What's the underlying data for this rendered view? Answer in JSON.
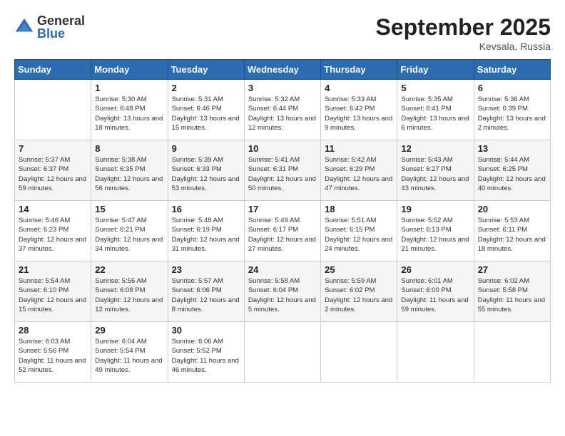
{
  "logo": {
    "general": "General",
    "blue": "Blue"
  },
  "title": "September 2025",
  "location": "Kevsala, Russia",
  "days_of_week": [
    "Sunday",
    "Monday",
    "Tuesday",
    "Wednesday",
    "Thursday",
    "Friday",
    "Saturday"
  ],
  "weeks": [
    [
      {
        "day": "",
        "sunrise": "",
        "sunset": "",
        "daylight": ""
      },
      {
        "day": "1",
        "sunrise": "Sunrise: 5:30 AM",
        "sunset": "Sunset: 6:48 PM",
        "daylight": "Daylight: 13 hours and 18 minutes."
      },
      {
        "day": "2",
        "sunrise": "Sunrise: 5:31 AM",
        "sunset": "Sunset: 6:46 PM",
        "daylight": "Daylight: 13 hours and 15 minutes."
      },
      {
        "day": "3",
        "sunrise": "Sunrise: 5:32 AM",
        "sunset": "Sunset: 6:44 PM",
        "daylight": "Daylight: 13 hours and 12 minutes."
      },
      {
        "day": "4",
        "sunrise": "Sunrise: 5:33 AM",
        "sunset": "Sunset: 6:42 PM",
        "daylight": "Daylight: 13 hours and 9 minutes."
      },
      {
        "day": "5",
        "sunrise": "Sunrise: 5:35 AM",
        "sunset": "Sunset: 6:41 PM",
        "daylight": "Daylight: 13 hours and 6 minutes."
      },
      {
        "day": "6",
        "sunrise": "Sunrise: 5:36 AM",
        "sunset": "Sunset: 6:39 PM",
        "daylight": "Daylight: 13 hours and 2 minutes."
      }
    ],
    [
      {
        "day": "7",
        "sunrise": "Sunrise: 5:37 AM",
        "sunset": "Sunset: 6:37 PM",
        "daylight": "Daylight: 12 hours and 59 minutes."
      },
      {
        "day": "8",
        "sunrise": "Sunrise: 5:38 AM",
        "sunset": "Sunset: 6:35 PM",
        "daylight": "Daylight: 12 hours and 56 minutes."
      },
      {
        "day": "9",
        "sunrise": "Sunrise: 5:39 AM",
        "sunset": "Sunset: 6:33 PM",
        "daylight": "Daylight: 12 hours and 53 minutes."
      },
      {
        "day": "10",
        "sunrise": "Sunrise: 5:41 AM",
        "sunset": "Sunset: 6:31 PM",
        "daylight": "Daylight: 12 hours and 50 minutes."
      },
      {
        "day": "11",
        "sunrise": "Sunrise: 5:42 AM",
        "sunset": "Sunset: 6:29 PM",
        "daylight": "Daylight: 12 hours and 47 minutes."
      },
      {
        "day": "12",
        "sunrise": "Sunrise: 5:43 AM",
        "sunset": "Sunset: 6:27 PM",
        "daylight": "Daylight: 12 hours and 43 minutes."
      },
      {
        "day": "13",
        "sunrise": "Sunrise: 5:44 AM",
        "sunset": "Sunset: 6:25 PM",
        "daylight": "Daylight: 12 hours and 40 minutes."
      }
    ],
    [
      {
        "day": "14",
        "sunrise": "Sunrise: 5:46 AM",
        "sunset": "Sunset: 6:23 PM",
        "daylight": "Daylight: 12 hours and 37 minutes."
      },
      {
        "day": "15",
        "sunrise": "Sunrise: 5:47 AM",
        "sunset": "Sunset: 6:21 PM",
        "daylight": "Daylight: 12 hours and 34 minutes."
      },
      {
        "day": "16",
        "sunrise": "Sunrise: 5:48 AM",
        "sunset": "Sunset: 6:19 PM",
        "daylight": "Daylight: 12 hours and 31 minutes."
      },
      {
        "day": "17",
        "sunrise": "Sunrise: 5:49 AM",
        "sunset": "Sunset: 6:17 PM",
        "daylight": "Daylight: 12 hours and 27 minutes."
      },
      {
        "day": "18",
        "sunrise": "Sunrise: 5:51 AM",
        "sunset": "Sunset: 6:15 PM",
        "daylight": "Daylight: 12 hours and 24 minutes."
      },
      {
        "day": "19",
        "sunrise": "Sunrise: 5:52 AM",
        "sunset": "Sunset: 6:13 PM",
        "daylight": "Daylight: 12 hours and 21 minutes."
      },
      {
        "day": "20",
        "sunrise": "Sunrise: 5:53 AM",
        "sunset": "Sunset: 6:11 PM",
        "daylight": "Daylight: 12 hours and 18 minutes."
      }
    ],
    [
      {
        "day": "21",
        "sunrise": "Sunrise: 5:54 AM",
        "sunset": "Sunset: 6:10 PM",
        "daylight": "Daylight: 12 hours and 15 minutes."
      },
      {
        "day": "22",
        "sunrise": "Sunrise: 5:56 AM",
        "sunset": "Sunset: 6:08 PM",
        "daylight": "Daylight: 12 hours and 12 minutes."
      },
      {
        "day": "23",
        "sunrise": "Sunrise: 5:57 AM",
        "sunset": "Sunset: 6:06 PM",
        "daylight": "Daylight: 12 hours and 8 minutes."
      },
      {
        "day": "24",
        "sunrise": "Sunrise: 5:58 AM",
        "sunset": "Sunset: 6:04 PM",
        "daylight": "Daylight: 12 hours and 5 minutes."
      },
      {
        "day": "25",
        "sunrise": "Sunrise: 5:59 AM",
        "sunset": "Sunset: 6:02 PM",
        "daylight": "Daylight: 12 hours and 2 minutes."
      },
      {
        "day": "26",
        "sunrise": "Sunrise: 6:01 AM",
        "sunset": "Sunset: 6:00 PM",
        "daylight": "Daylight: 11 hours and 59 minutes."
      },
      {
        "day": "27",
        "sunrise": "Sunrise: 6:02 AM",
        "sunset": "Sunset: 5:58 PM",
        "daylight": "Daylight: 11 hours and 55 minutes."
      }
    ],
    [
      {
        "day": "28",
        "sunrise": "Sunrise: 6:03 AM",
        "sunset": "Sunset: 5:56 PM",
        "daylight": "Daylight: 11 hours and 52 minutes."
      },
      {
        "day": "29",
        "sunrise": "Sunrise: 6:04 AM",
        "sunset": "Sunset: 5:54 PM",
        "daylight": "Daylight: 11 hours and 49 minutes."
      },
      {
        "day": "30",
        "sunrise": "Sunrise: 6:06 AM",
        "sunset": "Sunset: 5:52 PM",
        "daylight": "Daylight: 11 hours and 46 minutes."
      },
      {
        "day": "",
        "sunrise": "",
        "sunset": "",
        "daylight": ""
      },
      {
        "day": "",
        "sunrise": "",
        "sunset": "",
        "daylight": ""
      },
      {
        "day": "",
        "sunrise": "",
        "sunset": "",
        "daylight": ""
      },
      {
        "day": "",
        "sunrise": "",
        "sunset": "",
        "daylight": ""
      }
    ]
  ]
}
